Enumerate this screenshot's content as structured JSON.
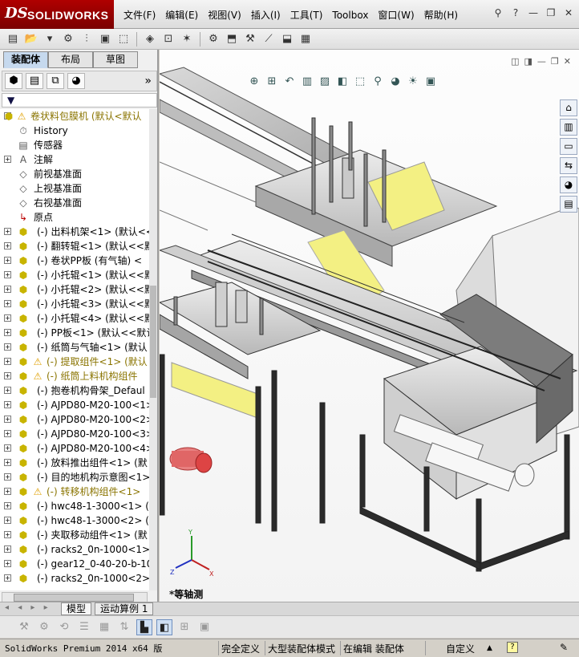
{
  "app": {
    "logo_ds": "DS",
    "logo_name": "SOLIDWORKS"
  },
  "menu": [
    "文件(F)",
    "编辑(E)",
    "视图(V)",
    "插入(I)",
    "工具(T)",
    "Toolbox",
    "窗口(W)",
    "帮助(H)"
  ],
  "window_controls": {
    "minimize": "—",
    "restore": "❐",
    "close": "✕",
    "help": "?"
  },
  "panel": {
    "tabs": [
      "装配体",
      "布局",
      "草图"
    ],
    "active_tab": "装配体",
    "more": "»",
    "filter_icon": "▼"
  },
  "tree": [
    {
      "label": "卷状料包膜机  (默认<默认",
      "type": "root",
      "exp": "-",
      "warn": true
    },
    {
      "label": "History",
      "type": "history"
    },
    {
      "label": "传感器",
      "type": "sensor"
    },
    {
      "label": "注解",
      "type": "annot",
      "exp": "+"
    },
    {
      "label": "前视基准面",
      "type": "plane"
    },
    {
      "label": "上视基准面",
      "type": "plane"
    },
    {
      "label": "右视基准面",
      "type": "plane"
    },
    {
      "label": "原点",
      "type": "origin"
    },
    {
      "label": "(-) 出料机架<1> (默认<<",
      "type": "part",
      "exp": "+"
    },
    {
      "label": "(-) 翻转辊<1> (默认<<默",
      "type": "part",
      "exp": "+"
    },
    {
      "label": "(-) 卷状PP板 (有气轴) <",
      "type": "part",
      "exp": "+"
    },
    {
      "label": "(-) 小托辊<1> (默认<<默",
      "type": "part",
      "exp": "+"
    },
    {
      "label": "(-) 小托辊<2> (默认<<默",
      "type": "part",
      "exp": "+"
    },
    {
      "label": "(-) 小托辊<3> (默认<<默",
      "type": "part",
      "exp": "+"
    },
    {
      "label": "(-) 小托辊<4> (默认<<默",
      "type": "part",
      "exp": "+"
    },
    {
      "label": "(-) PP板<1> (默认<<默认",
      "type": "part",
      "exp": "+"
    },
    {
      "label": "(-) 纸筒与气轴<1> (默认",
      "type": "part",
      "exp": "+"
    },
    {
      "label": "(-) 提取组件<1> (默认",
      "type": "part",
      "exp": "+",
      "warn": true
    },
    {
      "label": "(-) 纸筒上料机构组件",
      "type": "part",
      "exp": "+",
      "warn": true
    },
    {
      "label": "(-) 抱卷机构骨架_Defaul",
      "type": "part",
      "exp": "+"
    },
    {
      "label": "(-) AJPD80-M20-100<1> (",
      "type": "part",
      "exp": "+"
    },
    {
      "label": "(-) AJPD80-M20-100<2> (",
      "type": "part",
      "exp": "+"
    },
    {
      "label": "(-) AJPD80-M20-100<3> (",
      "type": "part",
      "exp": "+"
    },
    {
      "label": "(-) AJPD80-M20-100<4> (",
      "type": "part",
      "exp": "+"
    },
    {
      "label": "(-) 放料推出组件<1> (默",
      "type": "part",
      "exp": "+"
    },
    {
      "label": "(-) 目的地机构示意图<1>",
      "type": "part",
      "exp": "+"
    },
    {
      "label": "(-) 转移机构组件<1>",
      "type": "part",
      "exp": "+",
      "warn": true
    },
    {
      "label": "(-) hwc48-1-3000<1> (默",
      "type": "part",
      "exp": "+"
    },
    {
      "label": "(-) hwc48-1-3000<2> (默",
      "type": "part",
      "exp": "+"
    },
    {
      "label": "(-) 夹取移动组件<1> (默",
      "type": "part",
      "exp": "+"
    },
    {
      "label": "(-) racks2_0n-1000<1> (",
      "type": "part",
      "exp": "+"
    },
    {
      "label": "(-) gear12_0-40-20-b-10",
      "type": "part",
      "exp": "+"
    },
    {
      "label": "(-) racks2_0n-1000<2> (",
      "type": "part",
      "exp": "+"
    }
  ],
  "bottom_tabs": [
    "模型",
    "运动算例 1"
  ],
  "bottom_nav": "◂ ◂ ▸ ▸",
  "view_label": "*等轴测",
  "triad": {
    "x": "X",
    "y": "Y",
    "z": "Z"
  },
  "status": {
    "product": "SolidWorks Premium 2014 x64 版",
    "s1": "完全定义",
    "s2": "大型装配体模式",
    "s3": "在编辑 装配体",
    "s4": "自定义",
    "s4_arrow": "▲"
  },
  "colors": {
    "accent_red": "#a00000",
    "warn": "#e0b000",
    "tab_active": "#c6d9ee"
  }
}
